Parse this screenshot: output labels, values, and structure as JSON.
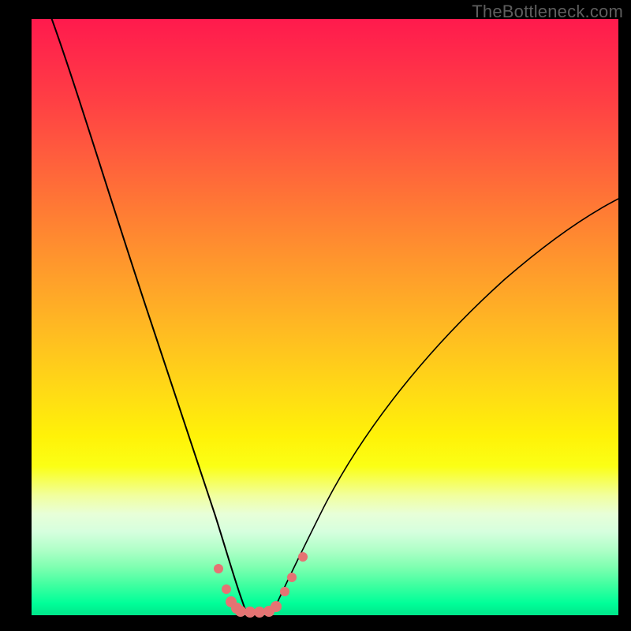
{
  "watermark": "TheBottleneck.com",
  "colors": {
    "frame": "#000000",
    "gradient_top": "#ff1a4d",
    "gradient_mid1": "#ff8e2f",
    "gradient_mid2": "#fff208",
    "gradient_bottom": "#00e58a",
    "curve": "#000000",
    "dots": "#e57373"
  },
  "chart_data": {
    "type": "line",
    "title": "",
    "xlabel": "",
    "ylabel": "",
    "xlim": [
      0,
      100
    ],
    "ylim": [
      0,
      100
    ],
    "series": [
      {
        "name": "left-curve",
        "x": [
          3,
          6,
          10,
          14,
          18,
          22,
          26,
          28,
          30,
          32,
          34,
          35
        ],
        "y": [
          100,
          84,
          67,
          53,
          41,
          30,
          19,
          13,
          8,
          4,
          1,
          0
        ]
      },
      {
        "name": "right-curve",
        "x": [
          41,
          43,
          46,
          50,
          55,
          62,
          70,
          80,
          90,
          100
        ],
        "y": [
          0,
          3,
          8,
          14,
          22,
          32,
          42,
          53,
          62,
          70
        ]
      }
    ],
    "points": [
      {
        "name": "left-dot-1",
        "x": 31.8,
        "y": 7.8,
        "r": 6
      },
      {
        "name": "left-dot-2",
        "x": 33.2,
        "y": 4.4,
        "r": 6
      },
      {
        "name": "left-line-1",
        "x": 34.0,
        "y": 2.2,
        "r": 7
      },
      {
        "name": "left-line-2",
        "x": 35.0,
        "y": 1.2,
        "r": 7
      },
      {
        "name": "floor-1",
        "x": 35.6,
        "y": 0.6,
        "r": 7
      },
      {
        "name": "floor-2",
        "x": 37.2,
        "y": 0.5,
        "r": 7
      },
      {
        "name": "floor-3",
        "x": 38.8,
        "y": 0.5,
        "r": 7
      },
      {
        "name": "floor-4",
        "x": 40.4,
        "y": 0.6,
        "r": 7
      },
      {
        "name": "right-up-1",
        "x": 41.6,
        "y": 1.4,
        "r": 7
      },
      {
        "name": "right-dot-1",
        "x": 43.2,
        "y": 4.0,
        "r": 6
      },
      {
        "name": "right-dot-2",
        "x": 44.4,
        "y": 6.4,
        "r": 6
      },
      {
        "name": "right-dot-3",
        "x": 46.2,
        "y": 9.8,
        "r": 6
      }
    ]
  }
}
